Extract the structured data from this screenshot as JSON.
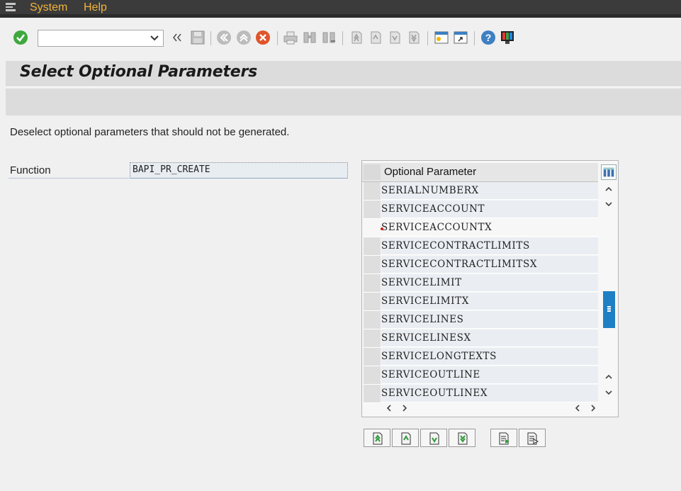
{
  "menu": {
    "items": [
      {
        "label": "System"
      },
      {
        "label": "Help"
      }
    ]
  },
  "toolbar": {
    "command_field_value": "",
    "icons": [
      "enter-icon",
      "back-arrows-icon",
      "save-icon",
      "back-icon",
      "exit-icon",
      "cancel-icon",
      "print-icon",
      "find-icon",
      "find-next-icon",
      "first-page-icon",
      "previous-page-icon",
      "next-page-icon",
      "last-page-icon",
      "create-session-icon",
      "shortcut-icon",
      "help-icon",
      "customize-layout-icon"
    ]
  },
  "page": {
    "title": "Select Optional Parameters",
    "instruction": "Deselect optional parameters that should not be generated."
  },
  "function_field": {
    "label": "Function",
    "value": "BAPI_PR_CREATE"
  },
  "table": {
    "column_header": "Optional Parameter",
    "rows": [
      "SERIALNUMBERX",
      "SERVICEACCOUNT",
      "SERVICEACCOUNTX",
      "SERVICECONTRACTLIMITS",
      "SERVICECONTRACTLIMITSX",
      "SERVICELIMIT",
      "SERVICELIMITX",
      "SERVICELINES",
      "SERVICELINESX",
      "SERVICELONGTEXTS",
      "SERVICEOUTLINE",
      "SERVICEOUTLINEX"
    ],
    "cursor_row_index": 2
  },
  "bottom_buttons": [
    "first-page-icon",
    "previous-page-icon",
    "next-page-icon",
    "last-page-icon",
    "select-all-icon",
    "deselect-all-icon"
  ],
  "colors": {
    "menu_text": "#f2b43a",
    "scroll_thumb": "#1f7fc4",
    "cell_bg": "#eaeef2"
  }
}
